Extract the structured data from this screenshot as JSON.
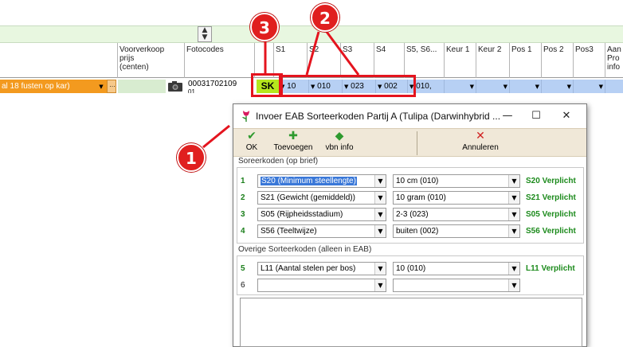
{
  "grid": {
    "spin_up": "▲",
    "spin_down": "▼",
    "columns": {
      "voorverkoop": "Voorverkoop\nprijs\n(centen)",
      "fotocodes": "Fotocodes",
      "s1": "S1",
      "s2": "S2",
      "s3": "S3",
      "s4": "S4",
      "s56": "S5, S6...",
      "keur1": "Keur 1",
      "keur2": "Keur 2",
      "pos1": "Pos 1",
      "pos2": "Pos 2",
      "pos3": "Pos3",
      "aan": "Aan\nPro\ninfo"
    },
    "row": {
      "packaging": "al 18 fusten op kar)",
      "fotocode": "00031702109",
      "fotocode_line2": "01",
      "sk": "SK",
      "s1": "10",
      "s2": "010",
      "s3": "023",
      "s4": "002",
      "s56": "010,"
    }
  },
  "badges": [
    "1",
    "2",
    "3"
  ],
  "colors": {
    "orange_cell": "#f39a1f",
    "blue_cell": "#b7d0f4",
    "sk_cell": "#b5e61d",
    "highlight_red": "#e4141e",
    "required_green": "#1b8a1b"
  },
  "dialog": {
    "title": "Invoer EAB Sorteerkoden Partij A (Tulipa (Darwinhybrid ...",
    "minimize": "—",
    "maximize": "☐",
    "close": "✕",
    "toolbar": {
      "ok": "OK",
      "toevoegen": "Toevoegen",
      "vbn_info": "vbn info",
      "annuleren": "Annuleren"
    },
    "group1_label": "Soreerkoden (op brief)",
    "group2_label": "Overige Sorteerkoden (alleen in EAB)",
    "rows": [
      {
        "num": "1",
        "code": "S20 (Minimum steellengte)",
        "value": "10 cm (010)",
        "required": "S20 Verplicht"
      },
      {
        "num": "2",
        "code": "S21 (Gewicht (gemiddeld))",
        "value": "10 gram (010)",
        "required": "S21 Verplicht"
      },
      {
        "num": "3",
        "code": "S05 (Rijpheidsstadium)",
        "value": "2-3 (023)",
        "required": "S05 Verplicht"
      },
      {
        "num": "4",
        "code": "S56 (Teeltwijze)",
        "value": "buiten (002)",
        "required": "S56 Verplicht"
      },
      {
        "num": "5",
        "code": "L11 (Aantal stelen per bos)",
        "value": "10 (010)",
        "required": "L11 Verplicht"
      },
      {
        "num": "6",
        "code": "",
        "value": "",
        "required": ""
      }
    ]
  }
}
